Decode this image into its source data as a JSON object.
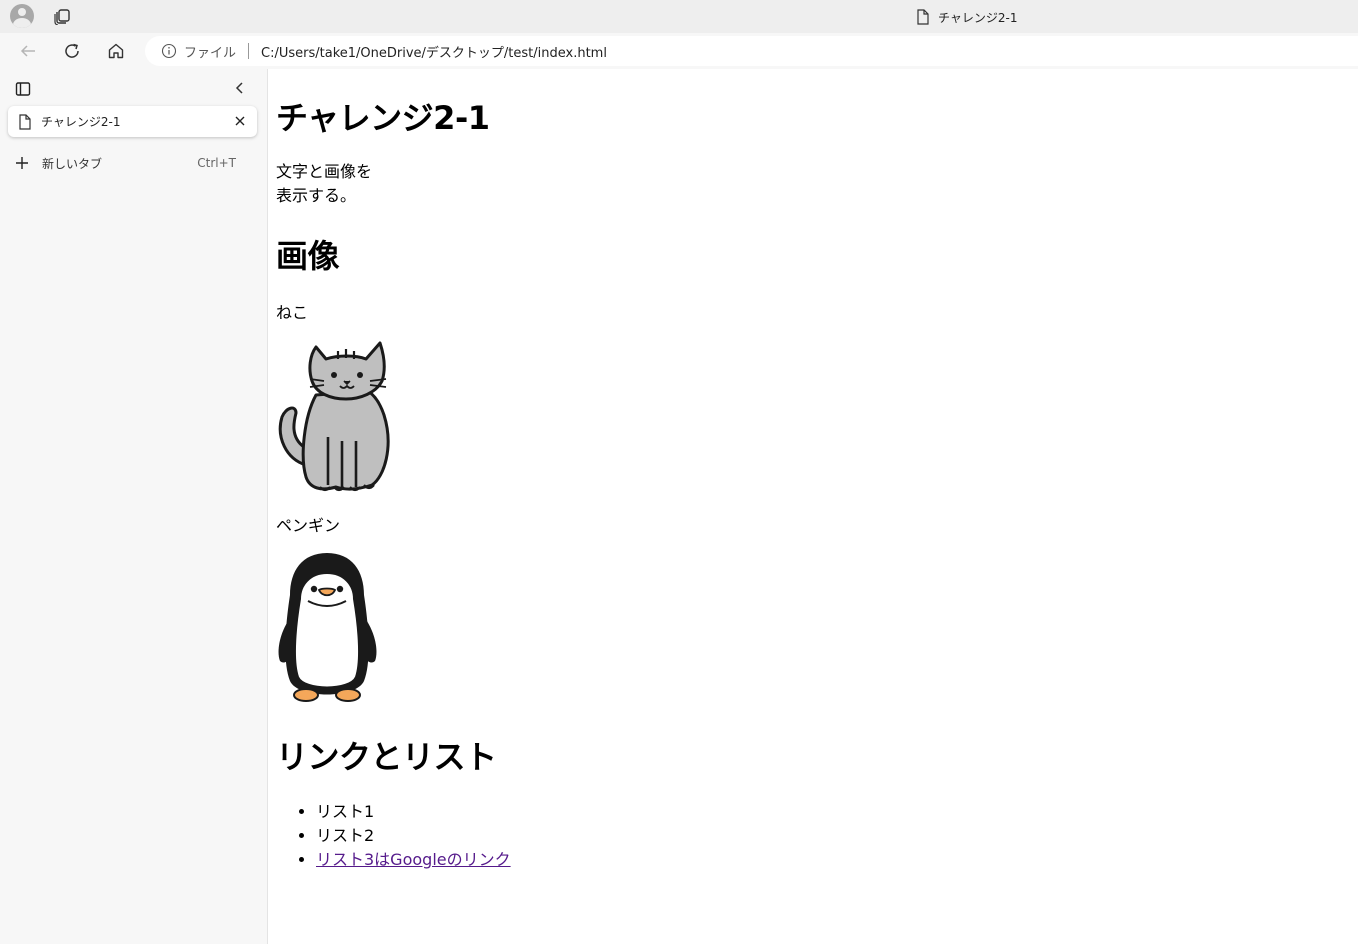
{
  "browser": {
    "window_title": "チャレンジ2-1",
    "address": {
      "scheme_label": "ファイル",
      "url": "C:/Users/take1/OneDrive/デスクトップ/test/index.html"
    },
    "sidebar": {
      "tabs": [
        {
          "label": "チャレンジ2-1"
        }
      ],
      "new_tab": {
        "label": "新しいタブ",
        "shortcut": "Ctrl+T"
      }
    },
    "colors": {
      "frame": "#eeeeee",
      "toolbar": "#f7f7f7",
      "visited_link": "#551a8b"
    }
  },
  "page": {
    "title": "チャレンジ2-1",
    "description_lines": [
      "文字と画像を",
      "表示する。"
    ],
    "images_heading": "画像",
    "cat_caption": "ねこ",
    "penguin_caption": "ペンギン",
    "links_heading": "リンクとリスト",
    "list_items": [
      "リスト1",
      "リスト2"
    ],
    "link_item": "リスト3はGoogleのリンク"
  }
}
